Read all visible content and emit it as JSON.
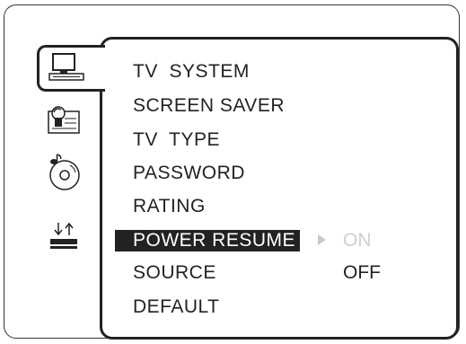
{
  "sidebar": {
    "tabs": [
      {
        "icon": "tv-monitor-icon",
        "selected": true
      },
      {
        "icon": "person-card-icon",
        "selected": false
      },
      {
        "icon": "disc-music-icon",
        "selected": false
      },
      {
        "icon": "up-down-arrows-icon",
        "selected": false
      }
    ]
  },
  "menu": {
    "items": [
      {
        "label": "TV  SYSTEM"
      },
      {
        "label": "SCREEN SAVER"
      },
      {
        "label": "TV  TYPE"
      },
      {
        "label": "PASSWORD"
      },
      {
        "label": "RATING"
      },
      {
        "label": "POWER RESUME",
        "selected": true
      },
      {
        "label": "SOURCE"
      },
      {
        "label": "DEFAULT"
      }
    ],
    "options": [
      {
        "label": "ON",
        "dim": true
      },
      {
        "label": "OFF",
        "dim": false
      }
    ]
  },
  "colors": {
    "foreground": "#222222",
    "highlight_bg": "#222222",
    "dim_text": "#cfcfcf"
  }
}
